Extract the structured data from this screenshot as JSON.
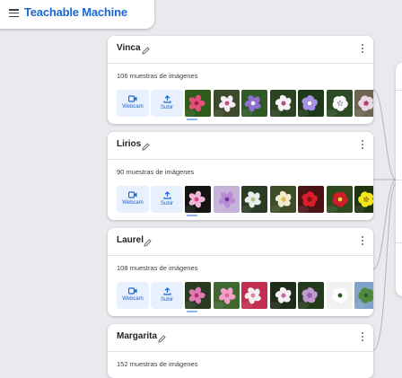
{
  "app": {
    "title": "Teachable Machine"
  },
  "buttons": {
    "webcam": "Webcam",
    "upload": "Subir"
  },
  "colors": {
    "accent": "#1967d2",
    "button_bg": "#e8f0fe",
    "background": "#e8eaed"
  },
  "classes": [
    {
      "name": "Vinca",
      "count": "106 muestras de imágenes",
      "thumbs": [
        {
          "bg": "#2e5a1a",
          "petal": "#e0527a",
          "center": "#a81d4a"
        },
        {
          "bg": "#3a4a2a",
          "petal": "#f4eef2",
          "center": "#c8487a"
        },
        {
          "bg": "#2f5a25",
          "petal": "#8f6fd0",
          "center": "#f0f0f0"
        },
        {
          "bg": "#2a4320",
          "petal": "#f6f4f8",
          "center": "#b24d86"
        },
        {
          "bg": "#1e3818",
          "petal": "#a892e8",
          "center": "#ffffff"
        },
        {
          "bg": "#2c4a24",
          "petal": "#faf8fa",
          "center": "#d8d2e0"
        },
        {
          "bg": "#6b6552",
          "petal": "#ead8e4",
          "center": "#c0387a"
        }
      ]
    },
    {
      "name": "Lirios",
      "count": "90 muestras de imágenes",
      "thumbs": [
        {
          "bg": "#141414",
          "petal": "#f0b8d8",
          "center": "#d83f86"
        },
        {
          "bg": "#c6b4d8",
          "petal": "#b98ad6",
          "center": "#6a3e9e"
        },
        {
          "bg": "#2b3c25",
          "petal": "#e8ecea",
          "center": "#b0c090"
        },
        {
          "bg": "#3d4e26",
          "petal": "#f2ead0",
          "center": "#e0c040"
        },
        {
          "bg": "#4a1414",
          "petal": "#d8202c",
          "center": "#8a0e14"
        },
        {
          "bg": "#2e4a1e",
          "petal": "#d21c28",
          "center": "#f0d040"
        },
        {
          "bg": "#1f3410",
          "petal": "#f4e61c",
          "center": "#c0a010"
        }
      ]
    },
    {
      "name": "Laurel",
      "count": "108 muestras de imágenes",
      "thumbs": [
        {
          "bg": "#2a3a22",
          "petal": "#e07ab4",
          "center": "#b82e74"
        },
        {
          "bg": "#3e6830",
          "petal": "#f2a0c8",
          "center": "#d8669e"
        },
        {
          "bg": "#c22e50",
          "petal": "#f2f0f0",
          "center": "#e08aa0"
        },
        {
          "bg": "#1e2c18",
          "petal": "#f4f0f4",
          "center": "#cc6aa4"
        },
        {
          "bg": "#243a1c",
          "petal": "#c098d0",
          "center": "#9460b0"
        },
        {
          "bg": "#f0f2f0",
          "petal": "#ffffff",
          "center": "#2e5a20"
        },
        {
          "bg": "#7ea2c8",
          "petal": "#4e8a3a",
          "center": "#2e5a22"
        }
      ]
    },
    {
      "name": "Margarita",
      "count": "152 muestras de imágenes",
      "thumbs": []
    }
  ]
}
